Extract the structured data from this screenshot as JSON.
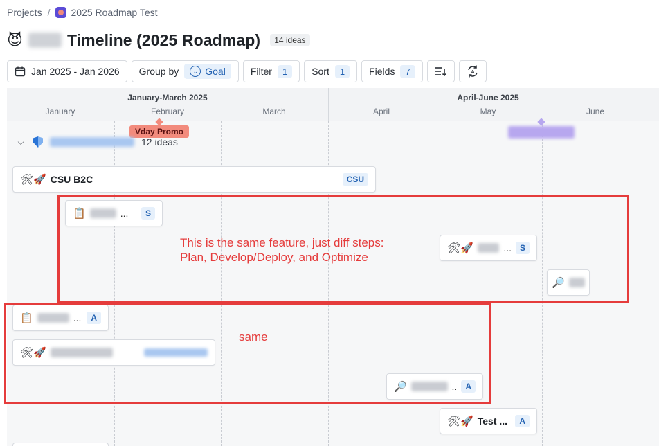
{
  "breadcrumb": {
    "projects": "Projects",
    "separator": "/",
    "current": "2025 Roadmap Test"
  },
  "header": {
    "emoji": "😈",
    "title": "Timeline (2025 Roadmap)",
    "ideas_count": "14 ideas"
  },
  "toolbar": {
    "date_range": "Jan 2025 - Jan 2026",
    "group_by_label": "Group by",
    "group_by_value": "Goal",
    "filter_label": "Filter",
    "filter_count": "1",
    "sort_label": "Sort",
    "sort_count": "1",
    "fields_label": "Fields",
    "fields_count": "7",
    "icon_density": "density-icon",
    "icon_refresh": "auto-refresh-icon"
  },
  "timeline": {
    "quarters": [
      "January-March 2025",
      "April-June 2025"
    ],
    "months": [
      "January",
      "February",
      "March",
      "April",
      "May",
      "June"
    ]
  },
  "milestones": [
    {
      "label": "Vday Promo",
      "bg": "#f28b7d",
      "fg": "#5a1212"
    },
    {
      "label": "",
      "bg": "#b7a7ef",
      "fg": "#5b4bd6"
    }
  ],
  "group": {
    "count": "12 ideas"
  },
  "cards": [
    {
      "emoji": "🛠🚀",
      "name": "CSU B2C",
      "tag": "CSU"
    },
    {
      "emoji": "📋",
      "dots": "...",
      "tag": "S"
    },
    {
      "emoji": "🛠🚀",
      "dots": "...",
      "tag": "S"
    },
    {
      "emoji": "🔎",
      "dots": ""
    },
    {
      "emoji": "📋",
      "dots": "...",
      "tag": "A"
    },
    {
      "emoji": "🛠🚀",
      "dots": ""
    },
    {
      "emoji": "🔎",
      "dots": "..",
      "tag": "A"
    },
    {
      "emoji": "🛠🚀",
      "name": "Test ...",
      "tag": "A"
    }
  ],
  "annotations": {
    "note1_line1": "This is the same feature, just diff steps:",
    "note1_line2": "Plan, Develop/Deploy, and Optimize",
    "note2": "same",
    "color": "#e53c3c"
  },
  "colors": {
    "accent_blue": "#2463b3",
    "chip_bg": "#e6f0fb",
    "timeline_bg": "#f6f7f8",
    "header_bg": "#f2f3f5"
  }
}
